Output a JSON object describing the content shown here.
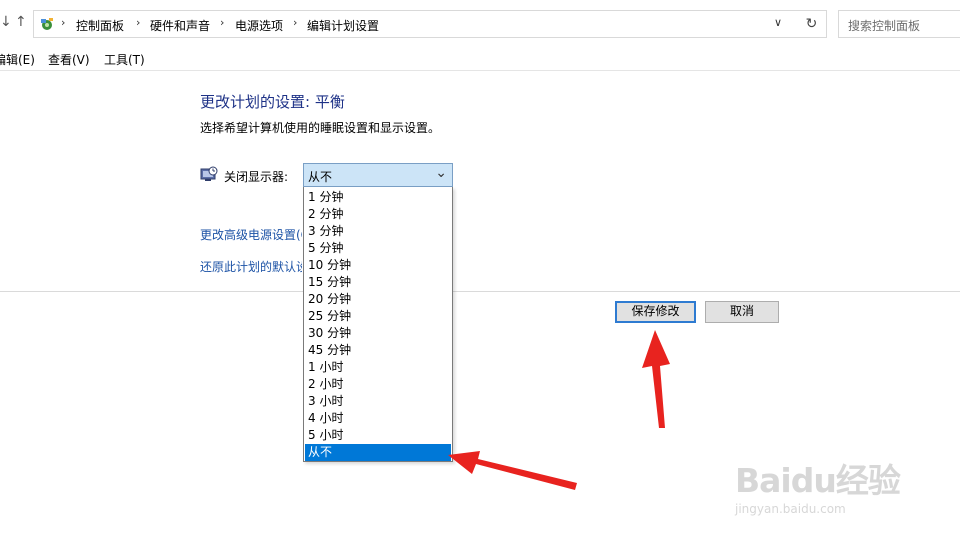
{
  "address_bar": {
    "breadcrumbs": [
      "控制面板",
      "硬件和声音",
      "电源选项",
      "编辑计划设置"
    ],
    "search_placeholder": "搜索控制面板"
  },
  "menu": {
    "items": [
      "编辑(E)",
      "查看(V)",
      "工具(T)"
    ]
  },
  "content": {
    "title": "更改计划的设置: 平衡",
    "description": "选择希望计算机使用的睡眠设置和显示设置。",
    "display_off_label": "关闭显示器:",
    "display_off_value": "从不",
    "link_advanced": "更改高级电源设置(C",
    "link_restore": "还原此计划的默认设"
  },
  "dropdown": {
    "options": [
      "1 分钟",
      "2 分钟",
      "3 分钟",
      "5 分钟",
      "10 分钟",
      "15 分钟",
      "20 分钟",
      "25 分钟",
      "30 分钟",
      "45 分钟",
      "1 小时",
      "2 小时",
      "3 小时",
      "4 小时",
      "5 小时",
      "从不"
    ],
    "selected": "从不"
  },
  "buttons": {
    "save": "保存修改",
    "cancel": "取消"
  },
  "watermark": {
    "brand": "Baidu经验",
    "url": "jingyan.baidu.com"
  },
  "colors": {
    "title": "#1e3287",
    "link": "#1d53a6",
    "selection": "#0078d7",
    "annotation": "#e8231f"
  },
  "icons": {
    "back": "arrow-left-icon",
    "up": "arrow-up-icon",
    "control_panel": "control-panel-icon",
    "refresh": "refresh-icon",
    "monitor": "monitor-clock-icon"
  }
}
